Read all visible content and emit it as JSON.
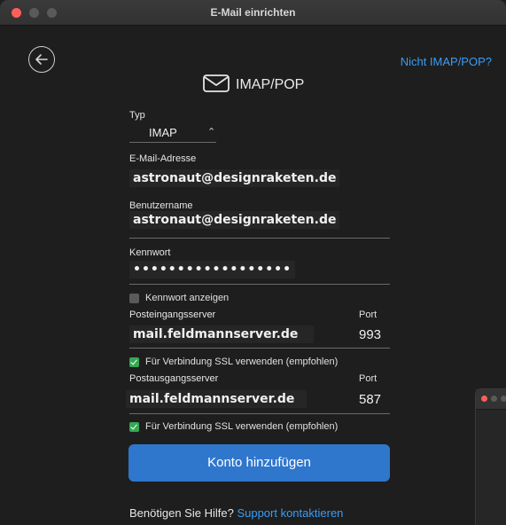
{
  "window": {
    "title": "E-Mail einrichten"
  },
  "top": {
    "not_imap_link": "Nicht IMAP/POP?"
  },
  "header": {
    "title": "IMAP/POP"
  },
  "form": {
    "type_label": "Typ",
    "type_value": "IMAP",
    "email_label": "E-Mail-Adresse",
    "email_value": "astronaut@designraketen.de",
    "username_label": "Benutzername",
    "username_value": "astronaut@designraketen.de",
    "password_label": "Kennwort",
    "password_value": "••••••••••••••••••",
    "show_password_label": "Kennwort anzeigen",
    "show_password_checked": false,
    "incoming_label": "Posteingangsserver",
    "incoming_server": "mail.feldmannserver.de",
    "incoming_port_label": "Port",
    "incoming_port": "993",
    "incoming_ssl_label": "Für Verbindung SSL verwenden (empfohlen)",
    "incoming_ssl_checked": true,
    "outgoing_label": "Postausgangsserver",
    "outgoing_server": "mail.feldmannserver.de",
    "outgoing_port_label": "Port",
    "outgoing_port": "587",
    "outgoing_ssl_label": "Für Verbindung SSL verwenden (empfohlen)",
    "outgoing_ssl_checked": true
  },
  "actions": {
    "add_account": "Konto hinzufügen"
  },
  "help": {
    "text": "Benötigen Sie Hilfe?",
    "link": "Support kontaktieren"
  },
  "colors": {
    "accent": "#2f77cd",
    "link": "#3b9cf5",
    "check": "#33a852",
    "close": "#ff5f57"
  }
}
